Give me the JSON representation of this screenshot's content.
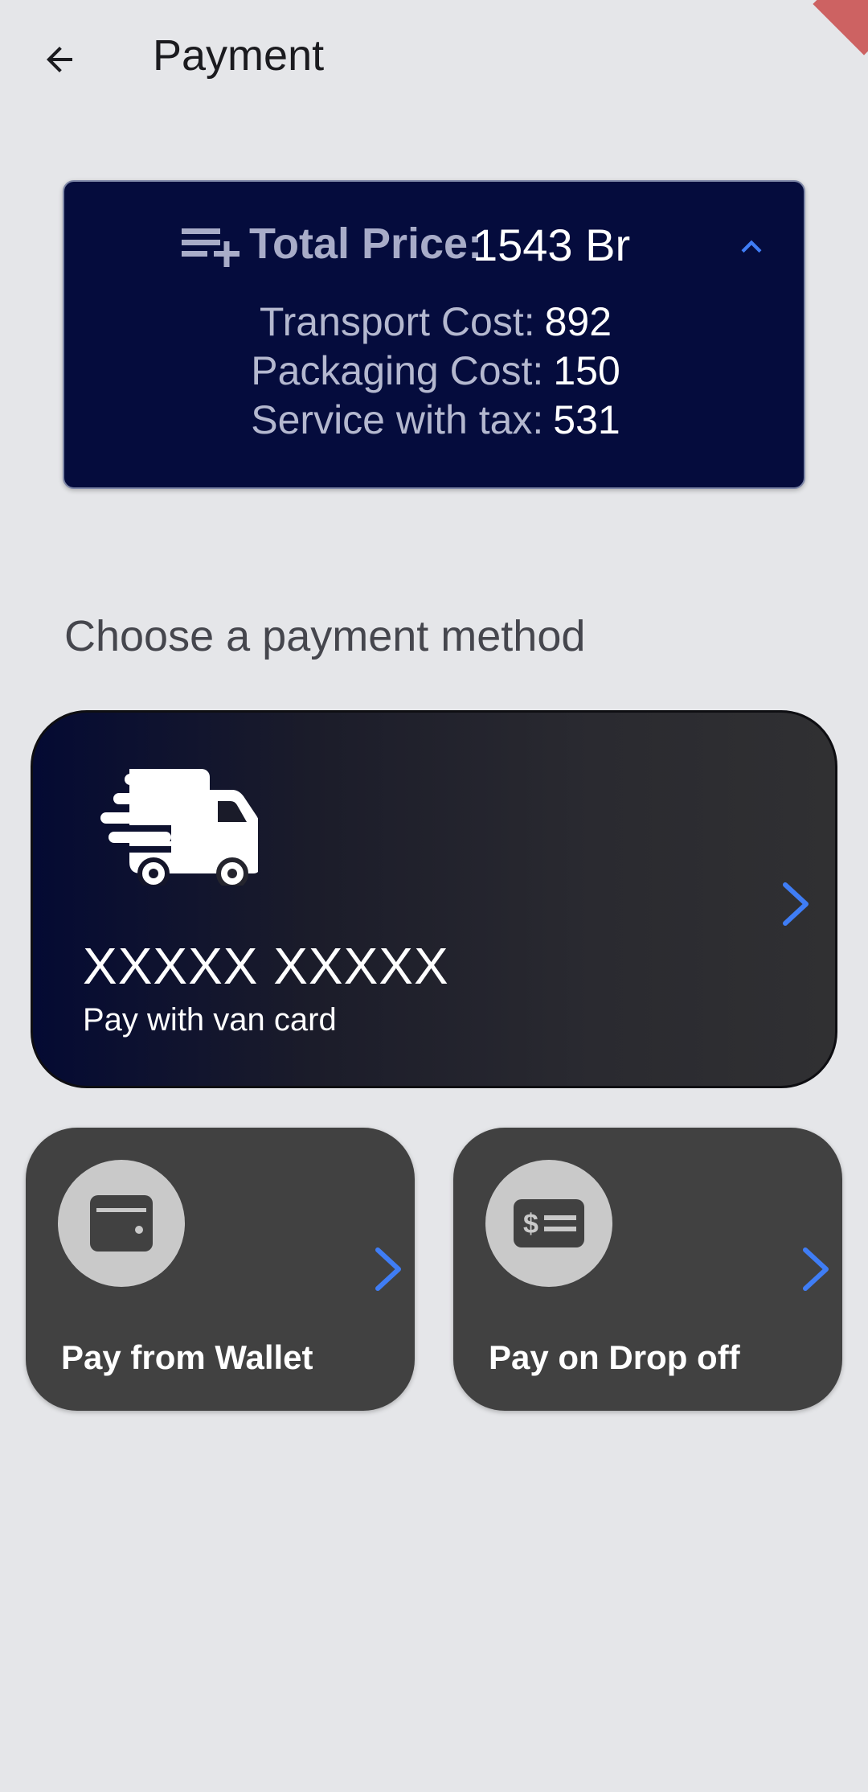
{
  "app_bar": {
    "title": "Payment"
  },
  "price_summary": {
    "total_label": "Total Price:",
    "total_value": "1543 Br",
    "lines": [
      {
        "label": "Transport Cost:",
        "value": "892"
      },
      {
        "label": "Packaging Cost:",
        "value": "150"
      },
      {
        "label": "Service with tax:",
        "value": "531"
      }
    ]
  },
  "section": {
    "title": "Choose a payment method"
  },
  "van_card": {
    "number": "XXXXX XXXXX",
    "subtitle": "Pay with van card"
  },
  "options": [
    {
      "label": "Pay from Wallet",
      "icon": "wallet-icon"
    },
    {
      "label": "Pay on Drop off",
      "icon": "cash-icon"
    }
  ],
  "colors": {
    "background": "#e5e6e9",
    "price_card": "#050c3d",
    "accent": "#3f7df5",
    "option_card": "#414141"
  }
}
